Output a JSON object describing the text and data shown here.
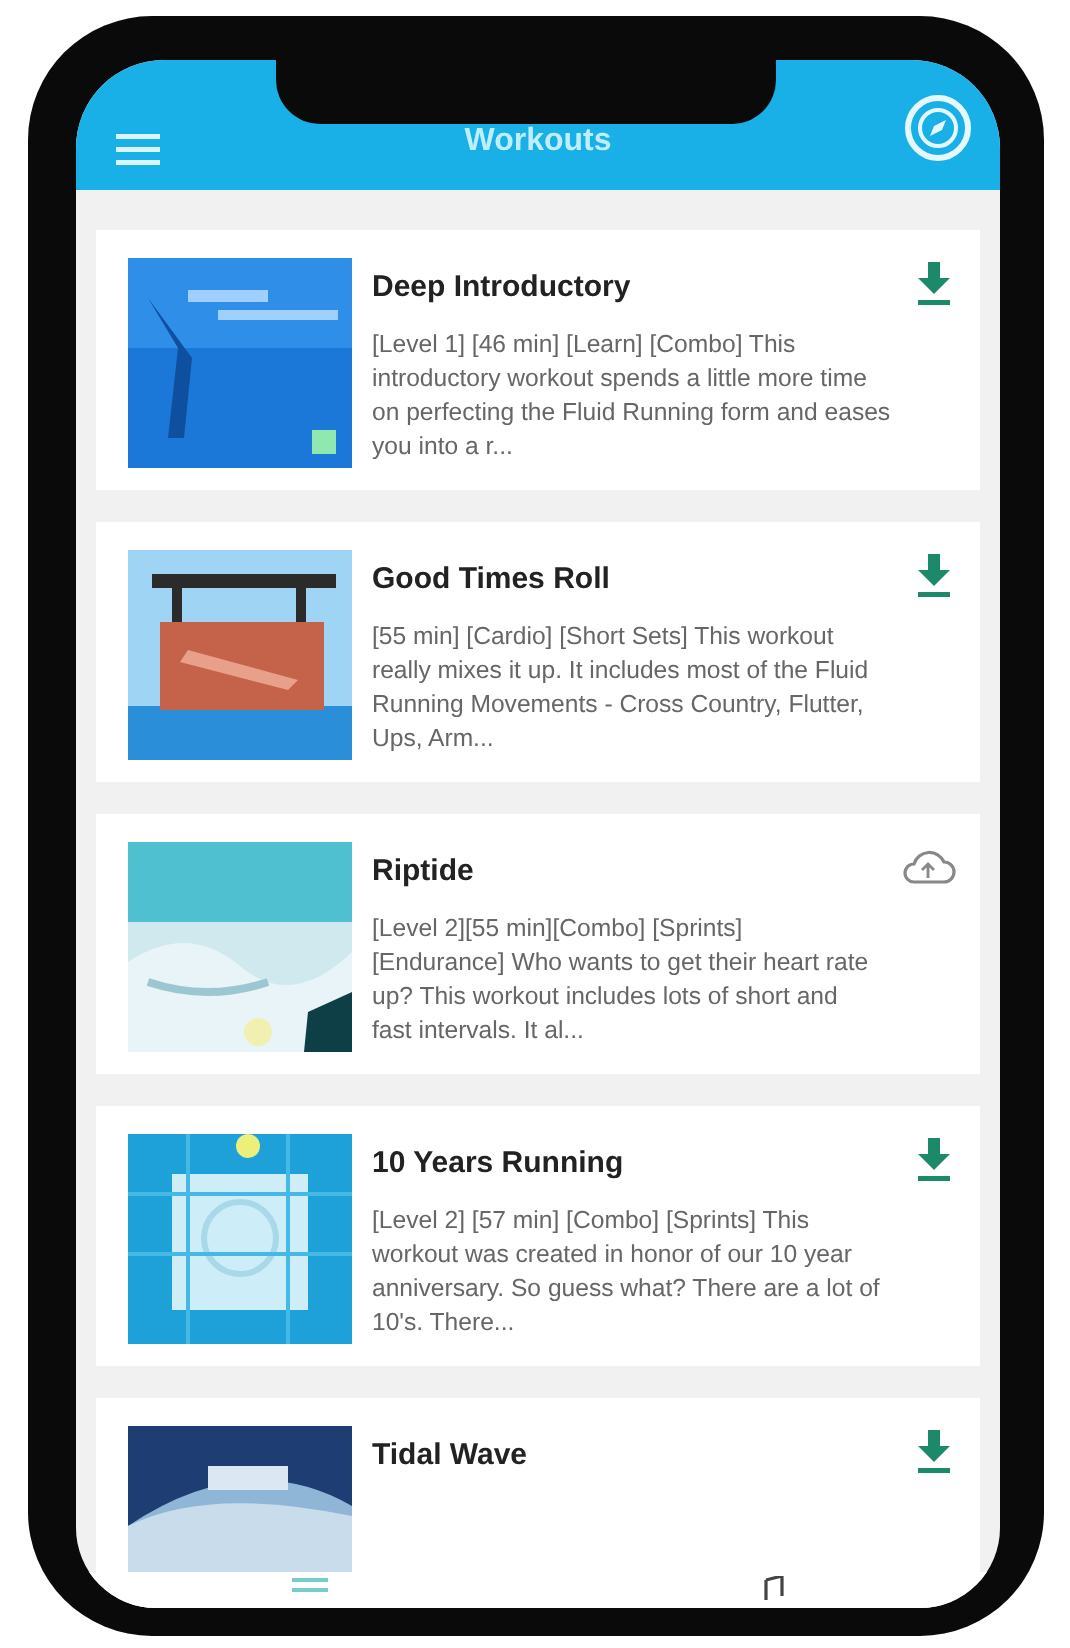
{
  "header": {
    "title": "Workouts"
  },
  "workouts": [
    {
      "title": "Deep Introductory",
      "description": "[Level 1] [46 min] [Learn] [Combo] This introductory workout spends a little more time on perfecting the Fluid Running form and eases you into a r...",
      "kind": "download"
    },
    {
      "title": "Good Times Roll",
      "description": "[55 min] [Cardio] [Short Sets] This workout really mixes it up. It includes most of the Fluid Running Movements - Cross Country, Flutter, Ups, Arm...",
      "kind": "download"
    },
    {
      "title": "Riptide",
      "description": "[Level 2][55 min][Combo] [Sprints] [Endurance] Who wants to get their heart rate up? This workout includes lots of short and fast intervals. It al...",
      "kind": "cloud"
    },
    {
      "title": "10 Years Running",
      "description": "[Level 2] [57 min] [Combo] [Sprints] This workout was created in honor of our 10 year anniversary.  So guess what? There are a lot of 10's.  There...",
      "kind": "download"
    },
    {
      "title": "Tidal Wave",
      "kind": "download"
    }
  ]
}
